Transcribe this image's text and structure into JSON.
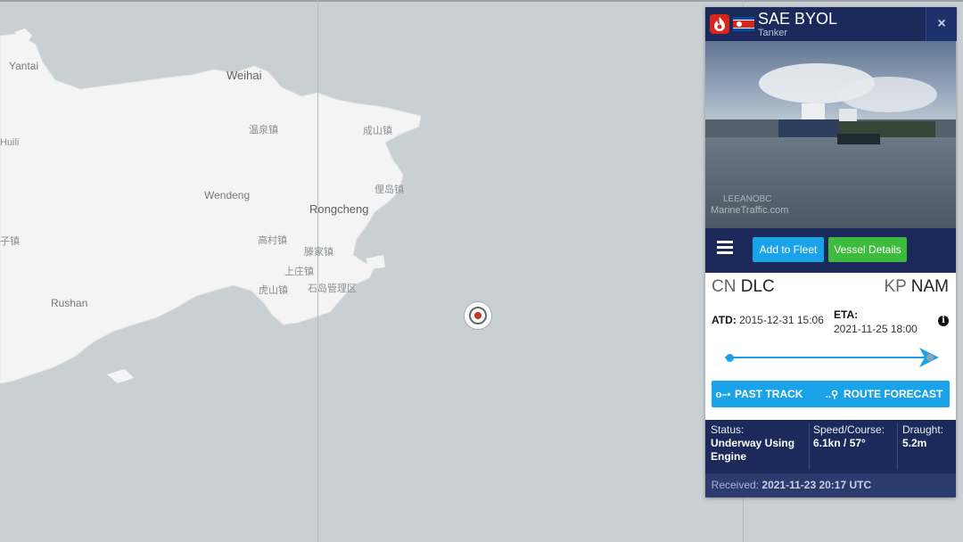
{
  "map": {
    "labels": {
      "yantai": "Yantai",
      "weihai": "Weihai",
      "huili": "Huili",
      "wendeng": "Wendeng",
      "rongcheng": "Rongcheng",
      "rushan": "Rushan",
      "wenquan": "温泉镇",
      "chengshan": "成山镇",
      "yashan": "俚岛镇",
      "gaocun": "高村镇",
      "tengjia": "滕家镇",
      "shangzhuang": "上庄镇",
      "huashan": "虎山镇",
      "shidao": "石岛管理区",
      "zizhen": "子镇"
    }
  },
  "panel": {
    "vessel_name": "SAE BYOL",
    "vessel_type": "Tanker",
    "close_symbol": "×",
    "photo_watermark": "MarineTraffic.com",
    "photo_credit": "LEEANOBC",
    "buttons": {
      "add_to_fleet": "Add to Fleet",
      "vessel_details": "Vessel Details",
      "past_track": "PAST TRACK",
      "route_forecast": "ROUTE FORECAST"
    },
    "departure": {
      "country": "CN",
      "port": "DLC"
    },
    "arrival": {
      "country": "KP",
      "port": "NAM"
    },
    "atd_label": "ATD:",
    "atd_value": "2015-12-31 15:06",
    "eta_label": "ETA:",
    "eta_value": "2021-11-25 18:00",
    "voyage_progress": 0.97,
    "status": {
      "status_label": "Status:",
      "status_value": "Underway Using Engine",
      "speed_label": "Speed/Course:",
      "speed_value": "6.1kn / 57°",
      "draught_label": "Draught:",
      "draught_value": "5.2m"
    },
    "received_label": "Received:",
    "received_value": "2021-11-23 20:17 UTC"
  },
  "colors": {
    "panel_navy": "#1b2a5a",
    "accent_blue": "#1aa3e8",
    "accent_green": "#3dbb3d",
    "sea": "#c9d0d4",
    "land": "#f4f4f4"
  },
  "icons": [
    "fire-icon",
    "flag-kp-icon",
    "close-icon",
    "menu-icon",
    "info-icon",
    "past-track-icon",
    "route-pin-icon",
    "vessel-marker-icon"
  ]
}
